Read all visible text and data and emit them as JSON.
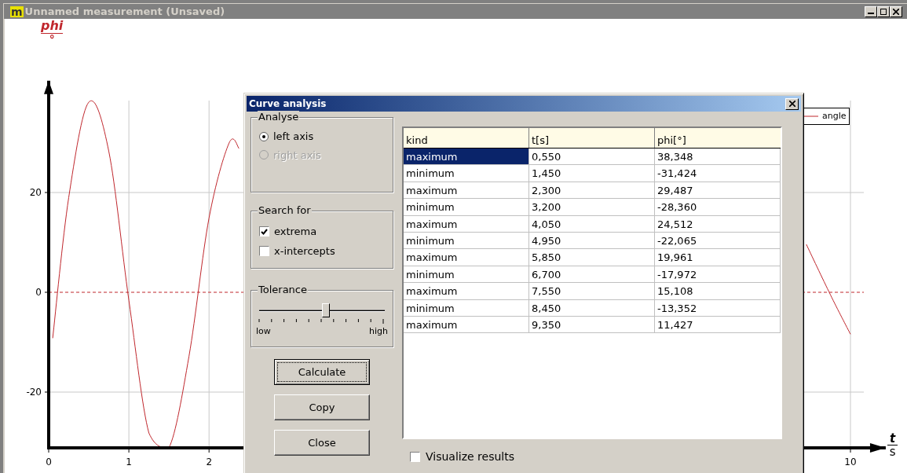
{
  "window": {
    "title": "Unnamed measurement (Unsaved)",
    "app_icon_letter": "m"
  },
  "plot": {
    "y_unit": "°",
    "x_unit": "s",
    "chart_data": {
      "type": "line",
      "xlabel": "t",
      "ylabel": "phi",
      "grid": true,
      "xlim": [
        0,
        10.44
      ],
      "ylim": [
        -31.2,
        42.4
      ],
      "xticks": [
        0,
        1,
        2,
        10
      ],
      "yticks": [
        20,
        0,
        -20
      ],
      "ref_lines": [
        {
          "axis": "y",
          "value": 0,
          "color": "#c0272d"
        }
      ],
      "x": [
        0.05,
        0.25,
        0.5,
        0.75,
        1,
        1.25,
        1.5,
        1.75,
        2,
        2.25,
        2.375,
        6,
        9.45,
        9.75,
        10
      ],
      "series": [
        {
          "name": "angle",
          "color": "#c0272d",
          "values": [
            -9.2,
            19.0,
            38.1,
            28.2,
            -1.6,
            -28.2,
            -31.2,
            -12.8,
            14.9,
            29.9,
            28.8,
            null,
            9.6,
            -0.5,
            -8.4
          ]
        }
      ]
    }
  },
  "dialog": {
    "title": "Curve analysis",
    "analyse": {
      "title": "Analyse",
      "options": [
        {
          "label": "left axis",
          "selected": true,
          "disabled": false
        },
        {
          "label": "right axis",
          "selected": false,
          "disabled": true
        }
      ]
    },
    "search": {
      "title": "Search for",
      "options": [
        {
          "label": "extrema",
          "checked": true
        },
        {
          "label": "x-intercepts",
          "checked": false
        }
      ]
    },
    "tolerance": {
      "title": "Tolerance",
      "level": 0.53,
      "low": "low",
      "high": "high"
    },
    "buttons": [
      {
        "label": "Calculate",
        "focused": true
      },
      {
        "label": "Copy",
        "focused": false
      },
      {
        "label": "Close",
        "focused": false
      }
    ],
    "table": {
      "columns": [
        "kind",
        "t[s]",
        "phi[°]"
      ],
      "rows": [
        {
          "kind": "maximum",
          "t": "0,550",
          "phi": "38,348",
          "selected": true
        },
        {
          "kind": "minimum",
          "t": "1,450",
          "phi": "-31,424",
          "selected": false
        },
        {
          "kind": "maximum",
          "t": "2,300",
          "phi": "29,487",
          "selected": false
        },
        {
          "kind": "minimum",
          "t": "3,200",
          "phi": "-28,360",
          "selected": false
        },
        {
          "kind": "maximum",
          "t": "4,050",
          "phi": "24,512",
          "selected": false
        },
        {
          "kind": "minimum",
          "t": "4,950",
          "phi": "-22,065",
          "selected": false
        },
        {
          "kind": "maximum",
          "t": "5,850",
          "phi": "19,961",
          "selected": false
        },
        {
          "kind": "minimum",
          "t": "6,700",
          "phi": "-17,972",
          "selected": false
        },
        {
          "kind": "maximum",
          "t": "7,550",
          "phi": "15,108",
          "selected": false
        },
        {
          "kind": "minimum",
          "t": "8,450",
          "phi": "-13,352",
          "selected": false
        },
        {
          "kind": "maximum",
          "t": "9,350",
          "phi": "11,427",
          "selected": false
        }
      ]
    },
    "visualize": {
      "label": "Visualize results",
      "checked": false
    }
  }
}
